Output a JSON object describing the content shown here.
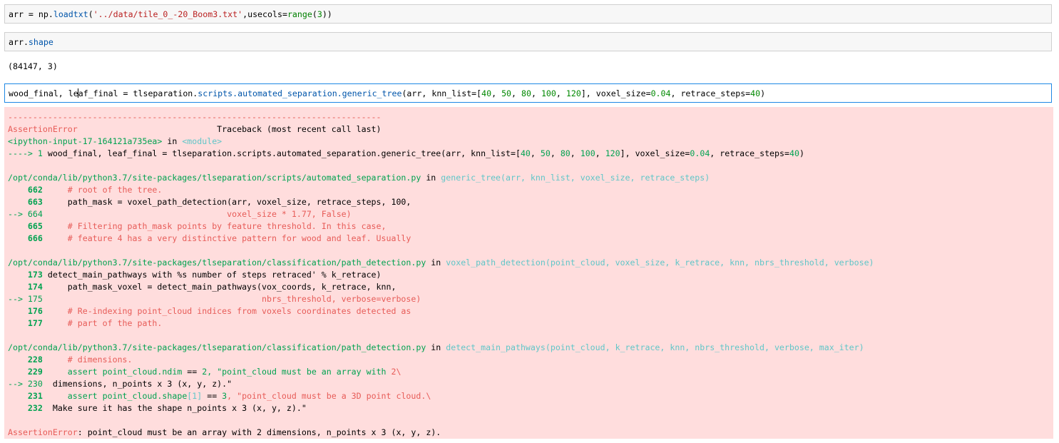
{
  "cell1": {
    "c1": "arr = ",
    "c2": "np.",
    "c3": "loadtxt",
    "c4": "(",
    "c5": "'../data/tile_0_-20_Boom3.txt'",
    "c6": ",usecols=",
    "c7": "range",
    "c8": "(",
    "c9": "3",
    "c10": "))"
  },
  "cell2": {
    "c1": "arr.",
    "c2": "shape"
  },
  "out2": "(84147, 3)",
  "cell3": {
    "c1": "wood_final, le",
    "c2": "af_final = tlseparation.",
    "c3": "scripts.automated_separation.generic_tree",
    "c4": "(arr, knn_list=[",
    "c5": "40",
    "c6": ", ",
    "c7": "50",
    "c8": ", ",
    "c9": "80",
    "c10": ", ",
    "c11": "100",
    "c12": ", ",
    "c13": "120",
    "c14": "], voxel_size=",
    "c15": "0.04",
    "c16": ", retrace_steps=",
    "c17": "40",
    "c18": ")"
  },
  "tb": {
    "separator": "---------------------------------------------------------------------------",
    "err_name": "AssertionError",
    "tb_header": "                            Traceback (most recent call last)",
    "input_ref": "<ipython-input-17-164121a735ea>",
    "in_word": " in ",
    "module": "<module>",
    "arrow1": "----> 1 ",
    "call1a": "wood_final, leaf_final = tlseparation.scripts.automated_separation.generic_tree(arr, knn_list=[",
    "n40": "40",
    "comma": ", ",
    "n50": "50",
    "n80": "80",
    "n100": "100",
    "n120": "120",
    "call1b": "], voxel_size=",
    "n004": "0.04",
    "call1c": ", retrace_steps=",
    "call1d": ")",
    "file1": "/opt/conda/lib/python3.7/site-packages/tlseparation/scripts/automated_separation.py",
    "func1": "generic_tree",
    "args1": "(arr, knn_list, voxel_size, retrace_steps)",
    "ln662": "    662",
    "src662": "     # root of the tree.",
    "ln663": "    663",
    "src663": "     path_mask = voxel_path_detection(arr, voxel_size, retrace_steps, 100,",
    "ln664": "--> 664",
    "src664": "                                     voxel_size * 1.77, False)",
    "ln665": "    665",
    "src665": "     # Filtering path_mask points by feature threshold. In this case,",
    "ln666": "    666",
    "src666": "     # feature 4 has a very distinctive pattern for wood and leaf. Usually",
    "file2": "/opt/conda/lib/python3.7/site-packages/tlseparation/classification/path_detection.py",
    "func2": "voxel_path_detection",
    "args2": "(point_cloud, voxel_size, k_retrace, knn, nbrs_threshold, verbose)",
    "ln173": "    173",
    "src173": " detect_main_pathways with %s number of steps retraced' % k_retrace)",
    "ln174": "    174",
    "src174": "     path_mask_voxel = detect_main_pathways(vox_coords, k_retrace, knn,",
    "ln175": "--> 175",
    "src175": "                                            nbrs_threshold, verbose=verbose)",
    "ln176": "    176",
    "src176": "     # Re-indexing point_cloud indices from voxels coordinates detected as",
    "ln177": "    177",
    "src177": "     # part of the path.",
    "file3": "/opt/conda/lib/python3.7/site-packages/tlseparation/classification/path_detection.py",
    "func3": "detect_main_pathways",
    "args3": "(point_cloud, k_retrace, knn, nbrs_threshold, verbose, max_iter)",
    "ln228": "    228",
    "src228": "     # dimensions.",
    "ln229": "    229",
    "src229a": "     assert point_cloud.ndim ",
    "eqeq": "==",
    "sp": " ",
    "n2": "2",
    "src229b": ", \"point_cloud must be an array ",
    "with": "with",
    "src229c": " 2\\",
    "ln230": "--> 230",
    "src230": "  dimensions, n_points x 3 (x, y, z).\"",
    "ln231": "    231",
    "src231a": "     assert point_cloud.shape",
    "src231b": "[1]",
    "src231c": " == ",
    "n3": "3",
    "src231d": ", \"point_cloud must be a 3D point cloud.\\",
    "ln232": "    232",
    "src232": "  Make sure it has the shape n_points x 3 (x, y, z).\"",
    "final_err": "AssertionError",
    "final_msg": ": point_cloud must be an array with 2 dimensions, n_points x 3 (x, y, z)."
  }
}
